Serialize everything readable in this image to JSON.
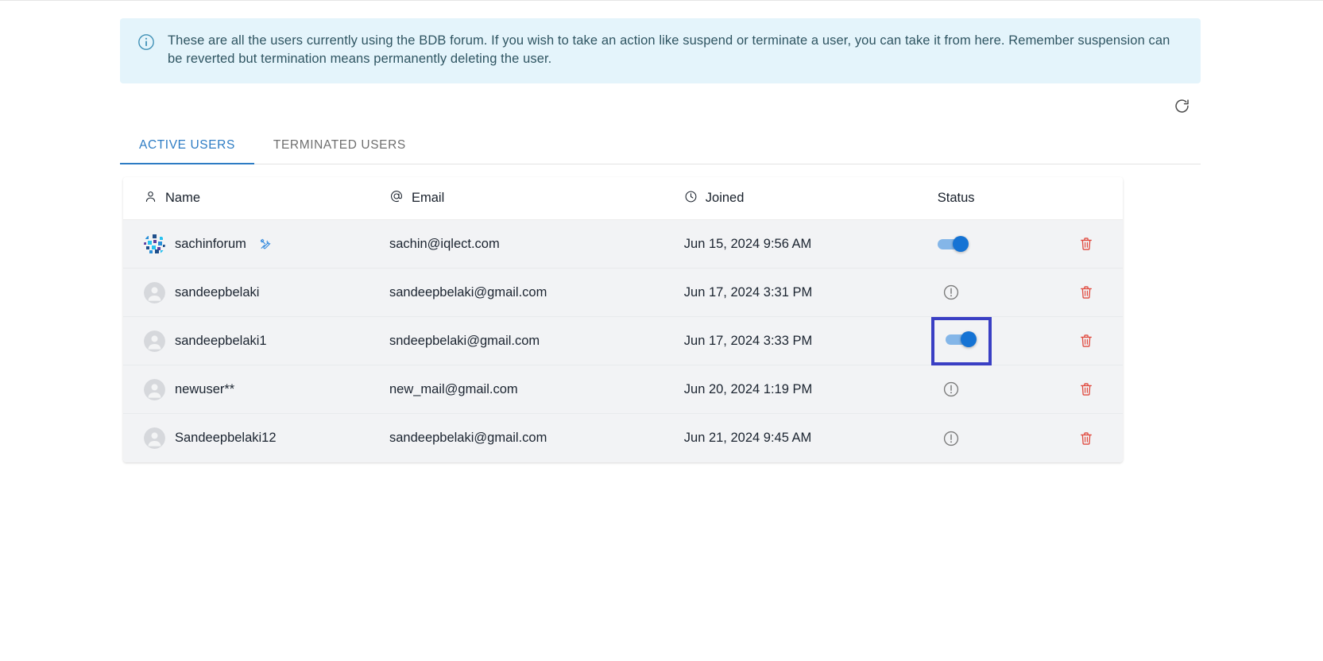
{
  "banner": {
    "icon": "info-circle-icon",
    "text": "These are all the users currently using the BDB forum. If you wish to take an action like suspend or terminate a user, you can take it from here. Remember suspension can be reverted but termination means permanently deleting the user."
  },
  "toolbar": {
    "refresh_icon": "refresh-icon"
  },
  "tabs": [
    {
      "label": "ACTIVE USERS",
      "active": true
    },
    {
      "label": "TERMINATED USERS",
      "active": false
    }
  ],
  "table": {
    "columns": [
      {
        "label": "Name",
        "icon": "person-icon"
      },
      {
        "label": "Email",
        "icon": "at-sign-icon"
      },
      {
        "label": "Joined",
        "icon": "clock-icon"
      },
      {
        "label": "Status",
        "icon": ""
      }
    ],
    "rows": [
      {
        "name": "sachinforum",
        "avatar": "identicon-avatar",
        "badge": "admin-tools-icon",
        "email": "sachin@iqlect.com",
        "joined": "Jun 15, 2024 9:56 AM",
        "status": "toggle-on",
        "highlighted": false,
        "delete_icon": "trash-icon"
      },
      {
        "name": "sandeepbelaki",
        "avatar": "default-person-avatar",
        "badge": "",
        "email": "sandeepbelaki@gmail.com",
        "joined": "Jun 17, 2024 3:31 PM",
        "status": "warning",
        "highlighted": false,
        "delete_icon": "trash-icon"
      },
      {
        "name": "sandeepbelaki1",
        "avatar": "default-person-avatar",
        "badge": "",
        "email": "sndeepbelaki@gmail.com",
        "joined": "Jun 17, 2024 3:33 PM",
        "status": "toggle-on",
        "highlighted": true,
        "delete_icon": "trash-icon"
      },
      {
        "name": "newuser**",
        "avatar": "default-person-avatar",
        "badge": "",
        "email": "new_mail@gmail.com",
        "joined": "Jun 20, 2024 1:19 PM",
        "status": "warning",
        "highlighted": false,
        "delete_icon": "trash-icon"
      },
      {
        "name": "Sandeepbelaki12",
        "avatar": "default-person-avatar",
        "badge": "",
        "email": "sandeepbelaki@gmail.com",
        "joined": "Jun 21, 2024 9:45 AM",
        "status": "warning",
        "highlighted": false,
        "delete_icon": "trash-icon"
      }
    ]
  },
  "colors": {
    "banner_bg": "#e4f4fb",
    "banner_text": "#2f5562",
    "tab_active": "#2d7cc4",
    "tab_inactive": "#6f6f6f",
    "row_bg": "#f2f3f5",
    "toggle_on": "#1573d4",
    "toggle_track": "#84b6e8",
    "highlight_border": "#3a3fc4",
    "trash": "#e04a3f",
    "warning": "#7b7b7b"
  }
}
